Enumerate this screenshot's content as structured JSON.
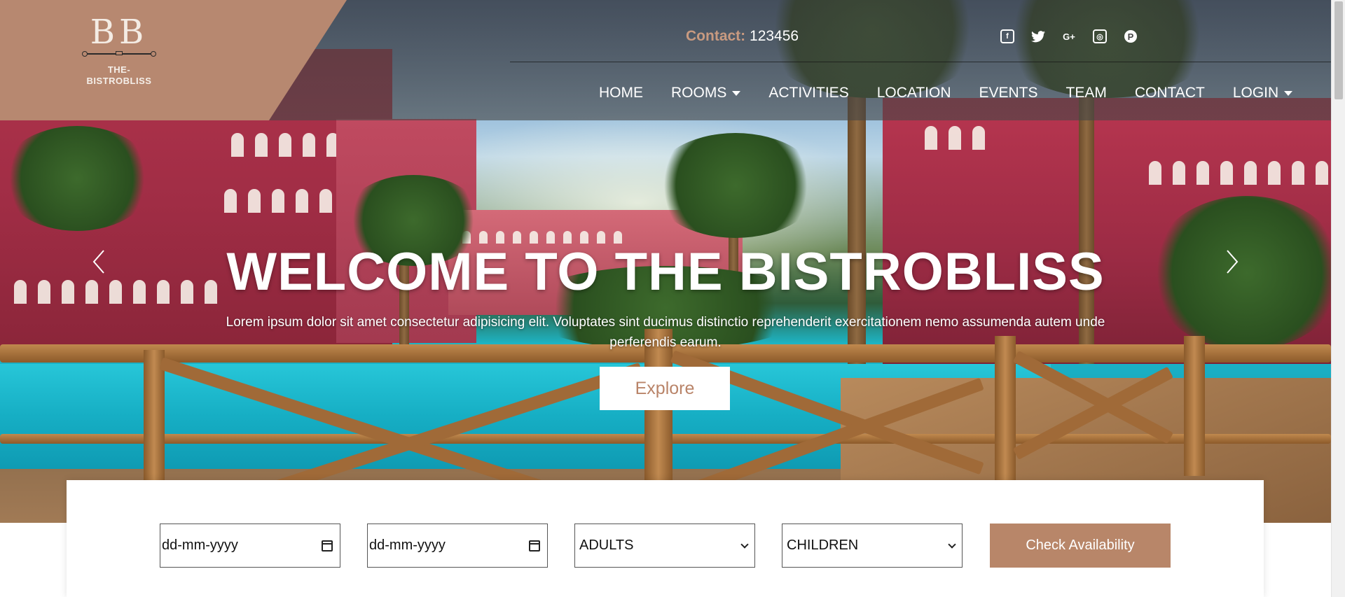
{
  "brand": {
    "logo_mark": "BB",
    "name_line1": "THE-",
    "name_line2": "BISTROBLISS",
    "color": "#b78870"
  },
  "contact": {
    "label": "Contact:",
    "value": "123456"
  },
  "social": [
    {
      "icon": "facebook-icon",
      "glyph": "f"
    },
    {
      "icon": "twitter-icon",
      "glyph": "🐦"
    },
    {
      "icon": "google-plus-icon",
      "glyph": "G+"
    },
    {
      "icon": "instagram-icon",
      "glyph": "◎"
    },
    {
      "icon": "pinterest-icon",
      "glyph": "P"
    }
  ],
  "nav": {
    "items": [
      {
        "label": "HOME",
        "dropdown": false
      },
      {
        "label": "ROOMS",
        "dropdown": true
      },
      {
        "label": "ACTIVITIES",
        "dropdown": false
      },
      {
        "label": "LOCATION",
        "dropdown": false
      },
      {
        "label": "EVENTS",
        "dropdown": false
      },
      {
        "label": "TEAM",
        "dropdown": false
      },
      {
        "label": "CONTACT",
        "dropdown": false
      },
      {
        "label": "LOGIN",
        "dropdown": true
      }
    ]
  },
  "hero": {
    "title": "WELCOME TO THE BISTROBLISS",
    "subtitle": "Lorem ipsum dolor sit amet consectetur adipisicing elit. Voluptates sint ducimus distinctio reprehenderit exercitationem nemo assumenda autem unde perferendis earum.",
    "cta_label": "Explore"
  },
  "booking": {
    "checkin_value": "dd-mm-yyyy",
    "checkout_value": "dd-mm-yyyy",
    "adults_selected": "ADULTS",
    "children_selected": "CHILDREN",
    "submit_label": "Check Availability"
  },
  "colors": {
    "accent": "#b88669",
    "contact_label": "#c89a80"
  }
}
